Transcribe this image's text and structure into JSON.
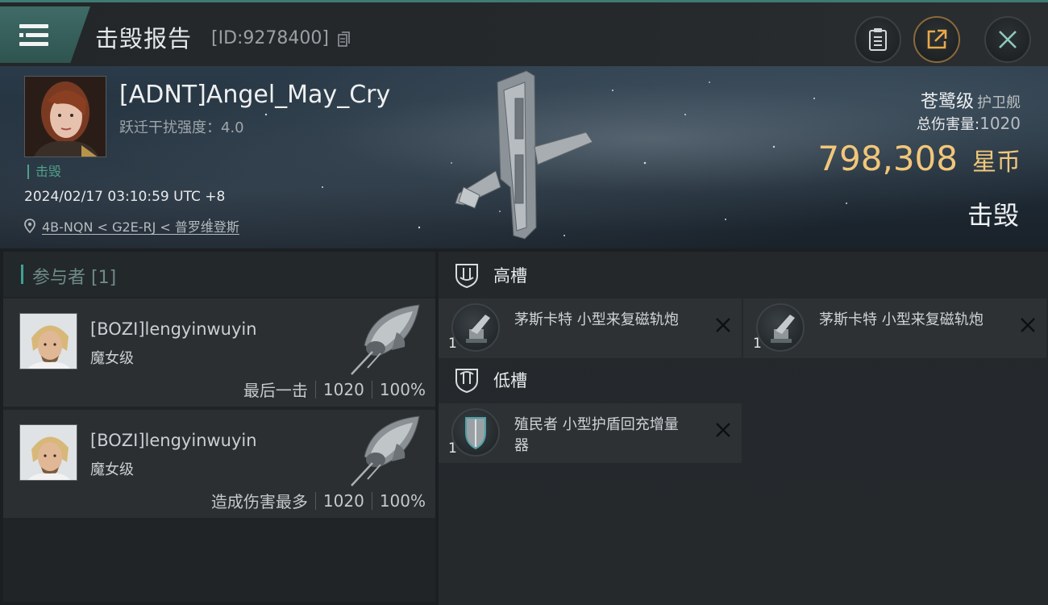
{
  "header": {
    "title": "击毁报告",
    "report_id": "[ID:9278400]",
    "icons": [
      "menu-icon",
      "copy-icon",
      "clipboard-icon",
      "share-icon",
      "close-icon"
    ]
  },
  "victim": {
    "pilot_name": "[ADNT]Angel_May_Cry",
    "warp_line": "跃迁干扰强度：4.0",
    "kill_tag": "击毁",
    "datetime": "2024/02/17 03:10:59 UTC +8",
    "location": "4B-NQN < G2E-RJ < 普罗维登斯",
    "ship_class": "苍鹭级",
    "ship_type": "护卫舰",
    "damage_label": "总伤害量:",
    "damage_value": "1020",
    "isk_value": "798,308",
    "isk_unit": "星币",
    "status": "击毁"
  },
  "participants": {
    "header": "参与者 [1]",
    "items": [
      {
        "name": "[BOZI]lengyinwuyin",
        "ship": "魔女级",
        "label": "最后一击",
        "damage": "1020",
        "percent": "100%"
      },
      {
        "name": "[BOZI]lengyinwuyin",
        "ship": "魔女级",
        "label": "造成伤害最多",
        "damage": "1020",
        "percent": "100%"
      }
    ]
  },
  "slots": {
    "high": {
      "title": "高槽",
      "modules": [
        {
          "name": "茅斯卡特 小型来复磁轨炮",
          "qty": "1"
        },
        {
          "name": "茅斯卡特 小型来复磁轨炮",
          "qty": "1"
        }
      ]
    },
    "low": {
      "title": "低槽",
      "modules": [
        {
          "name": "殖民者 小型护盾回充增量器",
          "qty": "1"
        }
      ]
    }
  },
  "colors": {
    "accent": "#3f7a73",
    "isk": "#f2c77a",
    "kill_tag": "#4fa08a"
  }
}
